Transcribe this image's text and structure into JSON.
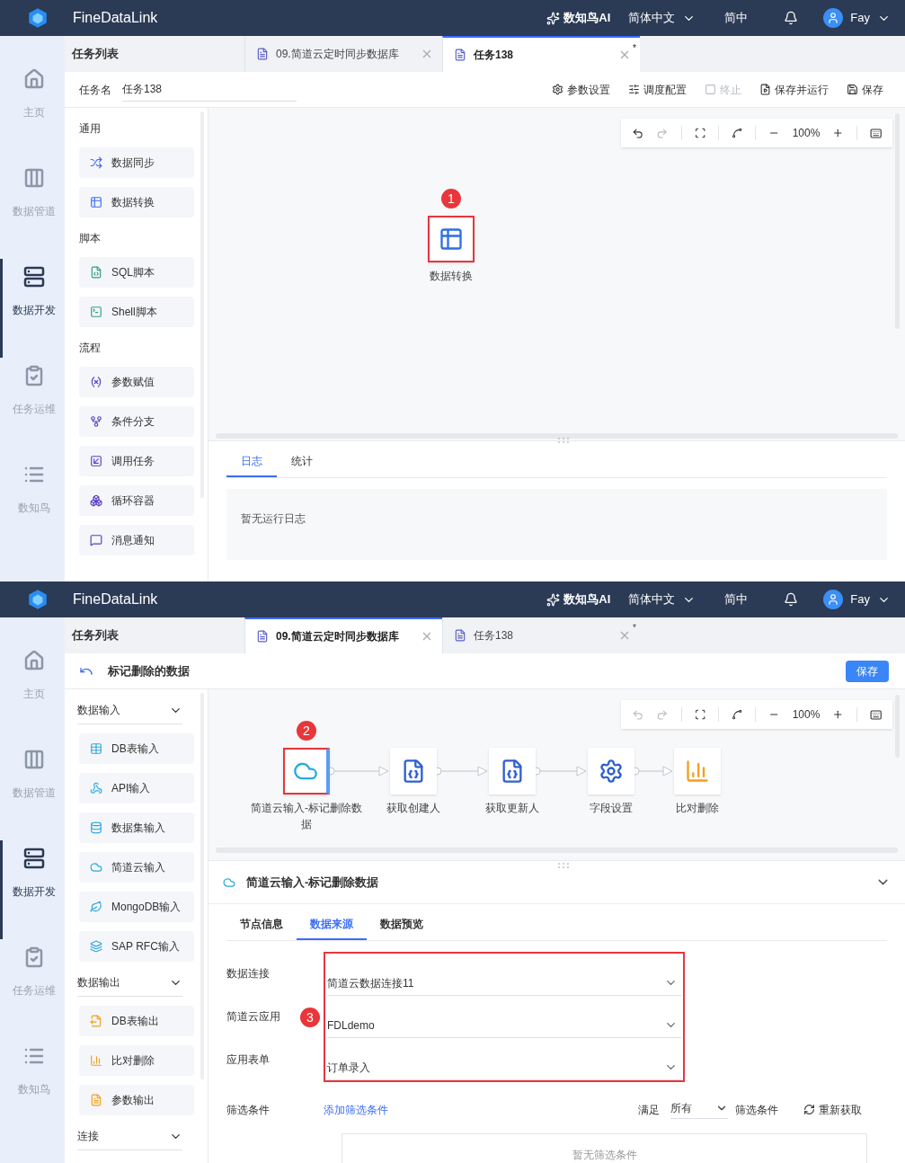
{
  "screens": [
    {
      "header": {
        "brand": "FineDataLink",
        "ai_label": "数知鸟AI",
        "language": "简体中文",
        "locale": "简中",
        "user": "Fay"
      },
      "nav": [
        {
          "label": "主页",
          "selected": false
        },
        {
          "label": "数据管道",
          "selected": false
        },
        {
          "label": "数据开发",
          "selected": true
        },
        {
          "label": "任务运维",
          "selected": false
        },
        {
          "label": "数知鸟",
          "selected": false
        }
      ],
      "task_list_title": "任务列表",
      "tabs": [
        {
          "label": "09.简道云定时同步数据库",
          "selected": false
        },
        {
          "label": "任务138",
          "selected": true,
          "modified_mark": "*"
        }
      ],
      "toolbar": {
        "kind": "task",
        "name_label": "任务名",
        "name_value": "任务138",
        "actions": [
          {
            "label": "参数设置",
            "disabled": false
          },
          {
            "label": "调度配置",
            "disabled": false
          },
          {
            "label": "终止",
            "disabled": true
          },
          {
            "label": "保存并运行",
            "disabled": false
          },
          {
            "label": "保存",
            "disabled": false
          }
        ]
      },
      "palette": [
        {
          "title": "通用",
          "collapsible": false,
          "items": [
            "数据同步",
            "数据转换"
          ]
        },
        {
          "title": "脚本",
          "collapsible": false,
          "items": [
            "SQL脚本",
            "Shell脚本"
          ]
        },
        {
          "title": "流程",
          "collapsible": false,
          "items": [
            "参数赋值",
            "条件分支",
            "调用任务",
            "循环容器",
            "消息通知"
          ]
        }
      ],
      "canvas": {
        "toolbar": {
          "zoom": "100%",
          "undo_disabled": false,
          "redo_disabled": true
        },
        "nodes": [
          {
            "label": "数据转换",
            "selected": false,
            "highlighted": true,
            "callout": "1"
          }
        ]
      },
      "bottom_panel": {
        "kind": "log",
        "tabs": [
          {
            "label": "日志",
            "selected": true
          },
          {
            "label": "统计",
            "selected": false
          }
        ],
        "empty_text": "暂无运行日志"
      }
    },
    {
      "header": {
        "brand": "FineDataLink",
        "ai_label": "数知鸟AI",
        "language": "简体中文",
        "locale": "简中",
        "user": "Fay"
      },
      "nav": [
        {
          "label": "主页",
          "selected": false
        },
        {
          "label": "数据管道",
          "selected": false
        },
        {
          "label": "数据开发",
          "selected": true
        },
        {
          "label": "任务运维",
          "selected": false
        },
        {
          "label": "数知鸟",
          "selected": false
        }
      ],
      "task_list_title": "任务列表",
      "tabs": [
        {
          "label": "09.简道云定时同步数据库",
          "selected": true
        },
        {
          "label": "任务138",
          "selected": false,
          "modified_mark": "*"
        }
      ],
      "toolbar": {
        "kind": "flow",
        "title": "标记删除的数据",
        "save": "保存"
      },
      "palette": [
        {
          "title": "数据输入",
          "collapsible": true,
          "items": [
            "DB表输入",
            "API输入",
            "数据集输入",
            "简道云输入",
            "MongoDB输入",
            "SAP RFC输入"
          ]
        },
        {
          "title": "数据输出",
          "collapsible": true,
          "items": [
            "DB表输出",
            "比对删除",
            "参数输出"
          ]
        },
        {
          "title": "连接",
          "collapsible": true
        }
      ],
      "canvas": {
        "toolbar": {
          "zoom": "100%",
          "undo_disabled": true,
          "redo_disabled": true
        },
        "nodes": [
          {
            "label": "简道云输入-标记删除数据",
            "selected": true,
            "highlighted": true,
            "callout": "2"
          },
          {
            "label": "获取创建人",
            "selected": false,
            "highlighted": false
          },
          {
            "label": "获取更新人",
            "selected": false,
            "highlighted": false
          },
          {
            "label": "字段设置",
            "selected": false,
            "highlighted": false
          },
          {
            "label": "比对删除",
            "selected": false,
            "highlighted": false
          }
        ]
      },
      "bottom_panel": {
        "kind": "detail",
        "title": "简道云输入-标记删除数据",
        "tabs": [
          {
            "label": "节点信息",
            "selected": false
          },
          {
            "label": "数据来源",
            "selected": true
          },
          {
            "label": "数据预览",
            "selected": false
          }
        ],
        "fields": [
          {
            "label": "数据连接",
            "value": "简道云数据连接11"
          },
          {
            "label": "简道云应用",
            "value": "FDLdemo"
          },
          {
            "label": "应用表单",
            "value": "订单录入"
          }
        ],
        "fields_callout": "3",
        "filter": {
          "label": "筛选条件",
          "add_link": "添加筛选条件",
          "match_label": "满足",
          "match_value": "所有",
          "condition_label": "筛选条件",
          "refresh": "重新获取",
          "empty_text": "暂无筛选条件"
        }
      }
    }
  ]
}
